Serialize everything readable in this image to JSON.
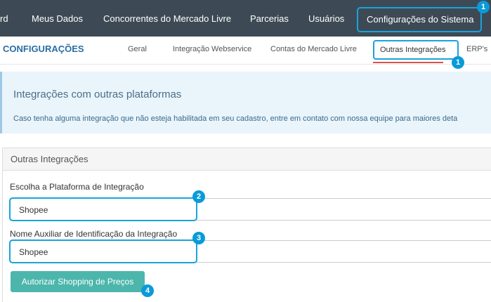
{
  "topnav": {
    "items": [
      "rd",
      "Meus Dados",
      "Concorrentes do Mercado Livre",
      "Parcerias",
      "Usuários",
      "Configurações do Sistema"
    ]
  },
  "subbar": {
    "brand": "CONFIGURAÇÕES",
    "tabs": [
      "Geral",
      "Integração Webservice",
      "Contas do Mercado Livre",
      "Outras Integrações",
      "ERP's"
    ]
  },
  "banner": {
    "title": "Integrações com outras plataformas",
    "text": "Caso tenha alguma integração que não esteja habilitada em seu cadastro, entre em contato com nossa equipe para maiores deta"
  },
  "panel": {
    "title": "Outras Integrações",
    "platform_label": "Escolha a Plataforma de Integração",
    "platform_value": "Shopee",
    "name_label": "Nome Auxiliar de Identificação da Integração",
    "name_value": "Shopee",
    "authorize_button": "Autorizar Shopping de Preços"
  },
  "badges": [
    "1",
    "1",
    "2",
    "3",
    "4"
  ],
  "colors": {
    "nav_bg": "#3d4a55",
    "highlight": "#1aa3dc",
    "badge": "#0a9ad9",
    "button": "#4cb6ac",
    "brand": "#2a6ea5"
  }
}
